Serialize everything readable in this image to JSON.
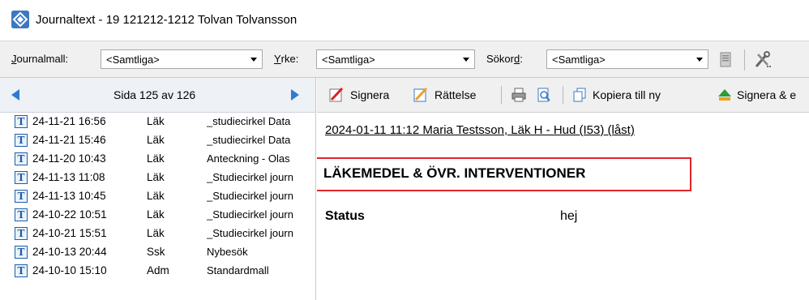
{
  "window": {
    "title": "Journaltext  -  19 121212-1212 Tolvan Tolvansson"
  },
  "filters": {
    "journalmall_label_ul": "J",
    "journalmall_label_rest": "ournalmall:",
    "journalmall_value": "<Samtliga>",
    "yrke_label_ul": "Y",
    "yrke_label_rest": "rke:",
    "yrke_value": "<Samtliga>",
    "sokord_label_pre": "Sökor",
    "sokord_label_ul": "d",
    "sokord_label_post": ":",
    "sokord_value": "<Samtliga>"
  },
  "pager": {
    "text": "Sida 125 av 126"
  },
  "entries": [
    {
      "datetime": "24-11-21 16:56",
      "role": "Läk",
      "desc": "_studiecirkel Data"
    },
    {
      "datetime": "24-11-21 15:46",
      "role": "Läk",
      "desc": "_studiecirkel Data"
    },
    {
      "datetime": "24-11-20 10:43",
      "role": "Läk",
      "desc": "Anteckning - Olas"
    },
    {
      "datetime": "24-11-13 11:08",
      "role": "Läk",
      "desc": "_Studiecirkel journ"
    },
    {
      "datetime": "24-11-13 10:45",
      "role": "Läk",
      "desc": "_Studiecirkel journ"
    },
    {
      "datetime": "24-10-22 10:51",
      "role": "Läk",
      "desc": "_Studiecirkel journ"
    },
    {
      "datetime": "24-10-21 15:51",
      "role": "Läk",
      "desc": "_Studiecirkel journ"
    },
    {
      "datetime": "24-10-13 20:44",
      "role": "Ssk",
      "desc": "Nybesök"
    },
    {
      "datetime": "24-10-10 15:10",
      "role": "Adm",
      "desc": "Standardmall"
    }
  ],
  "toolbar": {
    "signera": "Signera",
    "rattelse": "Rättelse",
    "kopiera": "Kopiera till ny",
    "signera_e": "Signera & e"
  },
  "document": {
    "header": "2024-01-11 11:12  Maria Testsson, Läk  H - Hud (I53)  (låst)",
    "section_title": "LÄKEMEDEL & ÖVR. INTERVENTIONER",
    "field_label": "Status",
    "field_value": "hej"
  },
  "colors": {
    "accent_blue": "#2f7bd3",
    "highlight_red": "#e0242b"
  }
}
